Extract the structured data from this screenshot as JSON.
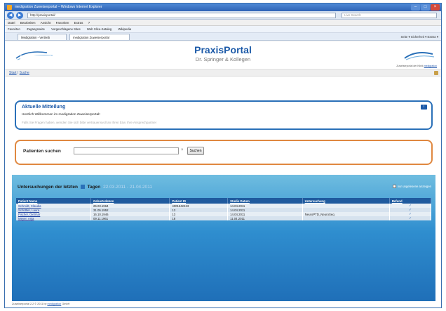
{
  "browser": {
    "title": "medigration Zuweiserportal – Windows Internet Explorer",
    "controls": {
      "minimize": "–",
      "maximize": "□",
      "close": "×"
    },
    "back_symbol": "◀",
    "forward_symbol": "▶",
    "address": "http://praxisportal/",
    "search_placeholder": "Live Search",
    "menu": [
      "Datei",
      "Bearbeiten",
      "Ansicht",
      "Favoriten",
      "Extras",
      "?"
    ],
    "favorites": [
      "Favoriten",
      "Zugangsseite",
      "Vorgeschlagene Sites",
      "Web Slice-Katalog",
      "Wikipedia"
    ],
    "tabs": [
      "Medigration - Vertrieb",
      "medigration Zuweiserportal"
    ],
    "tab_tools": "Seite ▾   Sicherheit ▾   Extras ▾"
  },
  "header": {
    "title": "PraxisPortal",
    "subtitle": "Dr. Springer & Kollegen",
    "owner_prefix": "Zuweiserportal der Klinik",
    "owner_link": "medigration"
  },
  "breadcrumb": {
    "start": "Start",
    "sep": " | ",
    "current": "Suche"
  },
  "news": {
    "title": "Aktuelle Mitteilung",
    "message": "Herzlich Willkommen im medigration Zuweiserportal!",
    "note": "Falls Sie Fragen haben, wenden Sie sich bitte vertrauensvoll an Ihren bzw. Ihre Ansprechpartner",
    "badge": "i"
  },
  "search": {
    "label": "Patienten suchen",
    "value": "",
    "clear": "×",
    "button": "Suchen"
  },
  "exams": {
    "heading_prefix": "Untersuchungen der letzten",
    "heading_unit": "Tagen",
    "date_range": "22.03.2011 - 21.04.2011",
    "only_unread_label": "nur ungelesene anzeigen",
    "columns": [
      "Patient Name",
      "Geburtsdatum",
      "Patient ID",
      "Studie Datum",
      "Untersuchung",
      "Befund"
    ],
    "rows": [
      [
        "Schmidt, Claudia",
        "25.03.1964",
        "4001642423",
        "14.04.2011",
        "",
        "✓"
      ],
      [
        "Schüttler, Laura",
        "31.05.1952",
        "13",
        "14.04.2011",
        "",
        "✓"
      ],
      [
        "Fischer, Dietmar",
        "16.10.1946",
        "13",
        "14.04.2011",
        "NeuroPTD_NeuroSeq",
        "✓"
      ],
      [
        "Meyer, Anja",
        "09.11.1961",
        "18",
        "11.04.2011",
        "",
        "✓"
      ]
    ]
  },
  "footer": {
    "prefix": "Zuweiserportal 2.2 © 2011 by",
    "link": "medigration",
    "suffix": "GmbH"
  }
}
